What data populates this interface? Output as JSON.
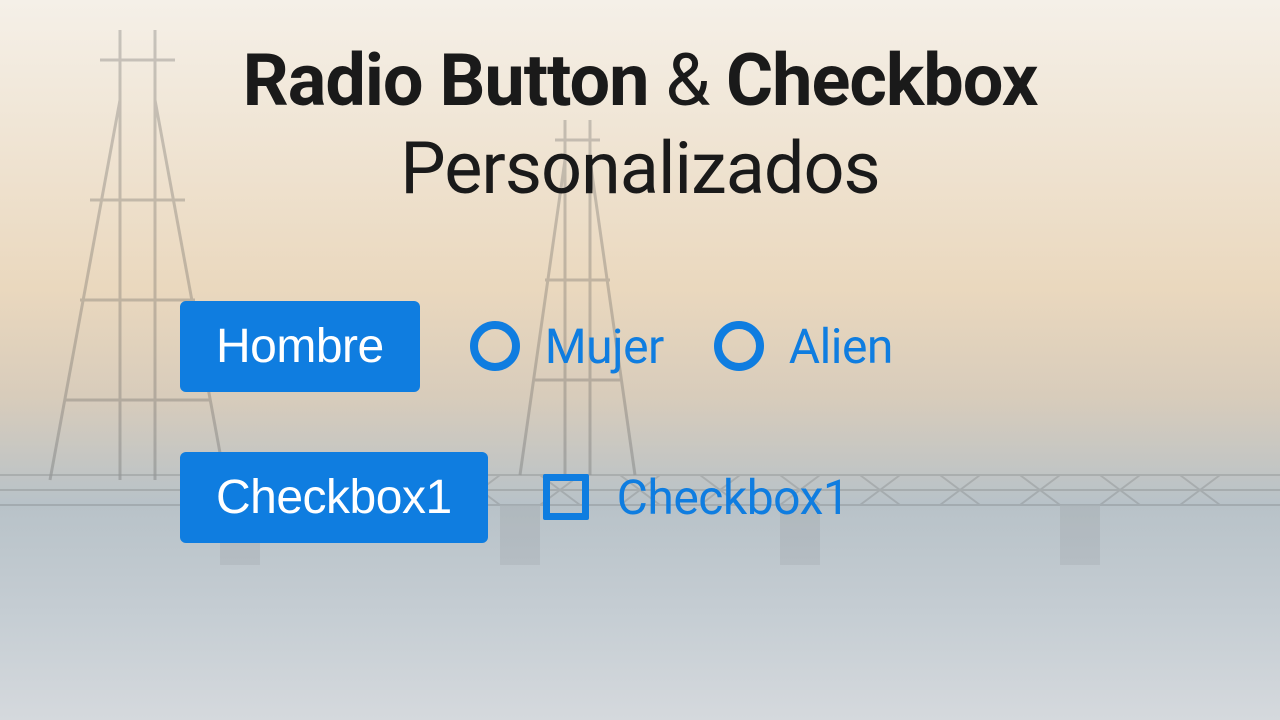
{
  "title": {
    "bold1": "Radio Button",
    "amp": " & ",
    "bold2": "Checkbox",
    "line2": "Personalizados"
  },
  "radios": {
    "selected": "Hombre",
    "option2": "Mujer",
    "option3": "Alien"
  },
  "checkboxes": {
    "selected": "Checkbox1",
    "option2": "Checkbox1"
  },
  "colors": {
    "accent": "#0f7de0"
  }
}
